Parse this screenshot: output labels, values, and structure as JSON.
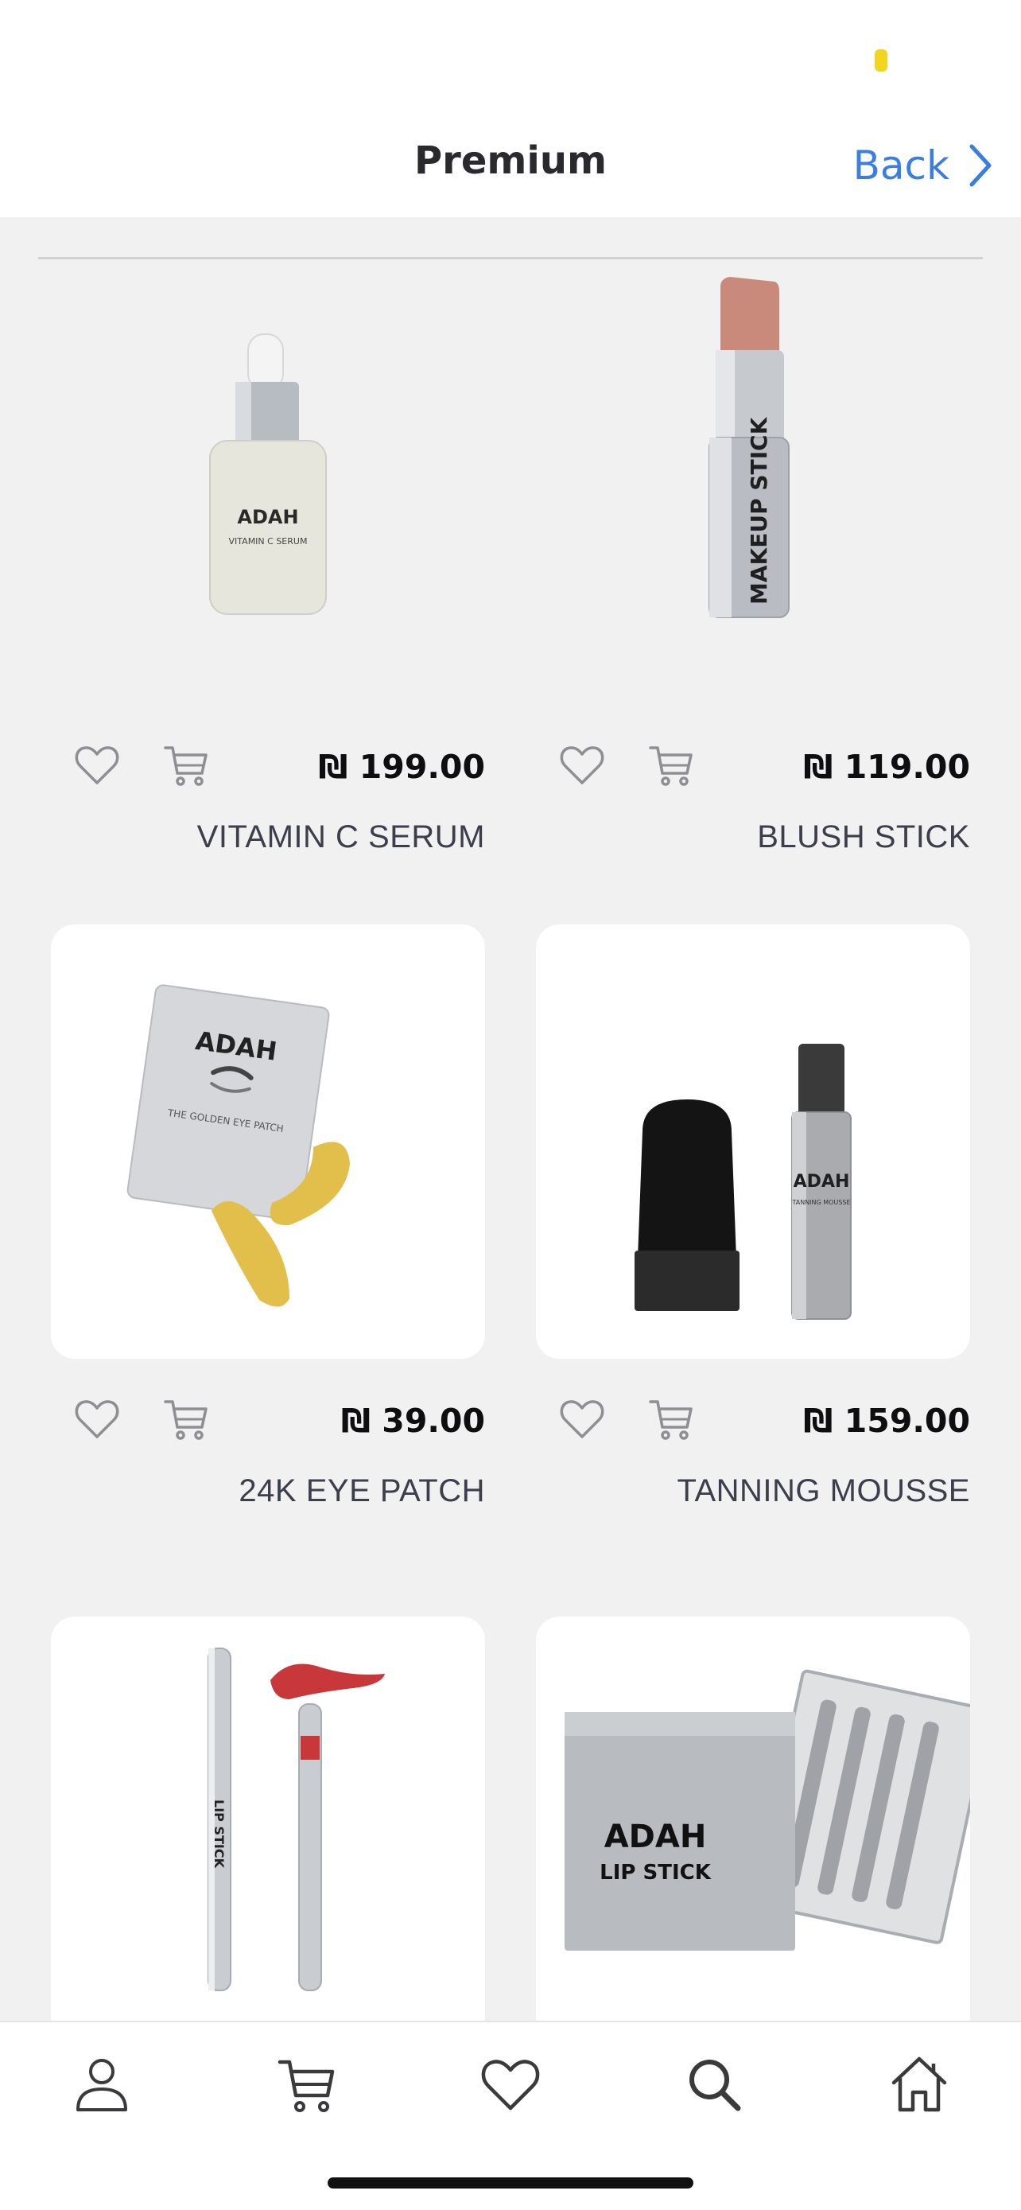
{
  "header": {
    "title": "Premium",
    "back_label": "Back"
  },
  "colors": {
    "accent": "#3a7ee0",
    "status_indicator": "#f3d51f",
    "background": "#f1f1f2",
    "text_dark": "#0e0e10"
  },
  "products": [
    {
      "name": "VITAMIN C SERUM",
      "price": "₪ 199.00",
      "image_label": "ADAH",
      "image_sub": "VITAMIN C SERUM"
    },
    {
      "name": "BLUSH STICK",
      "price": "₪ 119.00",
      "image_label": "MAKEUP STICK"
    },
    {
      "name": "24K EYE PATCH",
      "price": "₪ 39.00",
      "image_label": "ADAH",
      "image_sub": "THE GOLDEN EYE PATCH"
    },
    {
      "name": "TANNING MOUSSE",
      "price": "₪ 159.00",
      "image_label": "ADAH",
      "image_sub": "TANNING MOUSSE"
    },
    {
      "name": "",
      "price": "",
      "image_label": "LIP STICK"
    },
    {
      "name": "",
      "price": "",
      "image_label": "ADAH",
      "image_sub": "LIP STICK"
    }
  ],
  "tabbar": {
    "items": [
      "profile-icon",
      "cart-icon",
      "heart-icon",
      "search-icon",
      "home-icon"
    ]
  }
}
